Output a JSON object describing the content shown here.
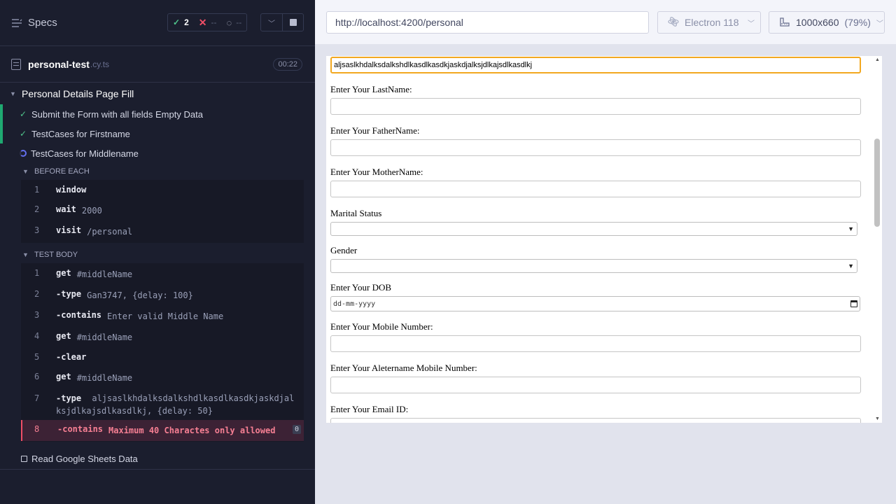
{
  "reporter": {
    "title": "Specs",
    "stats": {
      "passed": "2",
      "failed": "--",
      "pending": "--"
    },
    "spec": {
      "name": "personal-test",
      "ext": ".cy.ts",
      "duration": "00:22"
    },
    "suite": {
      "title": "Personal Details Page Fill"
    },
    "tests": [
      {
        "title": "Submit the Form with all fields Empty Data",
        "state": "passed"
      },
      {
        "title": "TestCases for Firstname",
        "state": "passed"
      },
      {
        "title": "TestCases for Middlename",
        "state": "running"
      }
    ],
    "before_each": {
      "title": "BEFORE EACH",
      "commands": [
        {
          "n": "1",
          "name": "window",
          "arg": ""
        },
        {
          "n": "2",
          "name": "wait",
          "arg": "2000"
        },
        {
          "n": "3",
          "name": "visit",
          "arg": "/personal"
        }
      ]
    },
    "test_body": {
      "title": "TEST BODY",
      "commands": [
        {
          "n": "1",
          "name": "get",
          "arg": "#middleName"
        },
        {
          "n": "2",
          "name": "-type",
          "arg": "Gan3747, {delay: 100}"
        },
        {
          "n": "3",
          "name": "-contains",
          "arg": "Enter valid Middle Name"
        },
        {
          "n": "4",
          "name": "get",
          "arg": "#middleName"
        },
        {
          "n": "5",
          "name": "-clear",
          "arg": ""
        },
        {
          "n": "6",
          "name": "get",
          "arg": "#middleName"
        },
        {
          "n": "7",
          "name": "-type",
          "arg": "aljsaslkhdalksdalkshdlkasdlkasdkjaskdjalksjdlkajsdlkasdlkj, {delay: 50}"
        },
        {
          "n": "8",
          "name": "-contains",
          "arg": "Maximum 40 Charactes only allowed",
          "badge": "0"
        }
      ]
    },
    "next_test": "Read Google Sheets Data"
  },
  "aut": {
    "url": "http://localhost:4200/personal",
    "browser": "Electron 118",
    "viewport": "1000x660",
    "zoom": "(79%)"
  },
  "form": {
    "middle_name_value": "aljsaslkhdalksdalkshdlkasdlkasdkjaskdjalksjdlkajsdlkasdlkj",
    "labels": {
      "last_name": "Enter Your LastName:",
      "father_name": "Enter Your FatherName:",
      "mother_name": "Enter Your MotherName:",
      "marital": "Marital Status",
      "gender": "Gender",
      "dob": "Enter Your DOB",
      "mobile": "Enter Your Mobile Number:",
      "alt_mobile": "Enter Your Aletername Mobile Number:",
      "email": "Enter Your Email ID:"
    },
    "dob_placeholder": "dd-mm-yyyy"
  },
  "colors": {
    "pass": "#4fc48b",
    "fail": "#f04e67",
    "focus": "#f2a820",
    "sidebar": "#1b1e2e"
  }
}
